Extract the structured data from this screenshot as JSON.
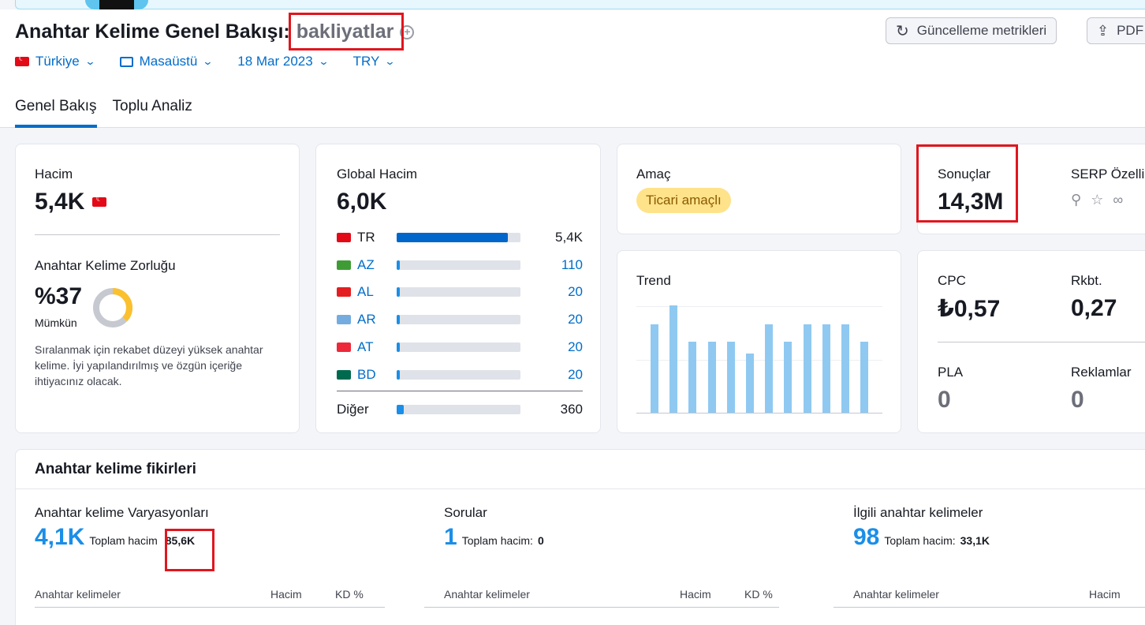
{
  "header": {
    "title": "Anahtar Kelime Genel Bakışı:",
    "keyword": "bakliyatlar",
    "buttons": {
      "refresh": "Güncelleme metrikleri",
      "pdf": "PDF"
    },
    "filters": {
      "country": "Türkiye",
      "device": "Masaüstü",
      "date": "18 Mar 2023",
      "currency": "TRY"
    },
    "tabs": [
      {
        "label": "Genel Bakış",
        "active": true
      },
      {
        "label": "Toplu Analiz",
        "active": false
      }
    ]
  },
  "volume": {
    "label": "Hacim",
    "value": "5,4K",
    "kd_label": "Anahtar Kelime Zorluğu",
    "kd_value": "%37",
    "kd_level": "Mümkün",
    "kd_percent": 37,
    "kd_description": "Sıralanmak için rekabet düzeyi yüksek anahtar kelime. İyi yapılandırılmış ve özgün içeriğe ihtiyacınız olacak."
  },
  "global": {
    "label": "Global Hacim",
    "value": "6,0K",
    "rows": [
      {
        "code": "TR",
        "value": "5,4K",
        "fraction": 0.9,
        "color": "#e30a17"
      },
      {
        "code": "AZ",
        "value": "110",
        "fraction": 0.02,
        "color": "#3f9c35"
      },
      {
        "code": "AL",
        "value": "20",
        "fraction": 0.02,
        "color": "#e41e20"
      },
      {
        "code": "AR",
        "value": "20",
        "fraction": 0.02,
        "color": "#74acdf"
      },
      {
        "code": "AT",
        "value": "20",
        "fraction": 0.02,
        "color": "#ed2939"
      },
      {
        "code": "BD",
        "value": "20",
        "fraction": 0.02,
        "color": "#006a4e"
      }
    ],
    "other": {
      "label": "Diğer",
      "value": "360",
      "fraction": 0.06
    }
  },
  "intent": {
    "label": "Amaç",
    "value": "Ticari amaçlı"
  },
  "results": {
    "label": "Sonuçlar",
    "value": "14,3M",
    "serp_label": "SERP Özelli"
  },
  "trend": {
    "label": "Trend",
    "values": [
      0.82,
      1.0,
      0.66,
      0.66,
      0.66,
      0.55,
      0.82,
      0.66,
      0.82,
      0.82,
      0.82,
      0.66
    ]
  },
  "metrics": {
    "cpc_label": "CPC",
    "cpc_value": "₺0,57",
    "comp_label": "Rkbt.",
    "comp_value": "0,27",
    "pla_label": "PLA",
    "pla_value": "0",
    "ads_label": "Reklamlar",
    "ads_value": "0"
  },
  "ideas": {
    "title": "Anahtar kelime fikirleri",
    "variations": {
      "label": "Anahtar kelime Varyasyonları",
      "count": "4,1K",
      "total_label": "Toplam hacim",
      "total": "85,6K"
    },
    "questions": {
      "label": "Sorular",
      "count": "1",
      "total_label": "Toplam hacim:",
      "total": "0"
    },
    "related": {
      "label": "İlgili anahtar kelimeler",
      "count": "98",
      "total_label": "Toplam hacim:",
      "total": "33,1K"
    },
    "col_keywords": "Anahtar kelimeler",
    "col_volume": "Hacim",
    "col_kd": "KD %"
  },
  "colors": {
    "accent": "#006dca",
    "highlight": "#e0161e",
    "bar": "#0066cc",
    "trend": "#8fc9f1",
    "intent": "#ffe38a"
  }
}
